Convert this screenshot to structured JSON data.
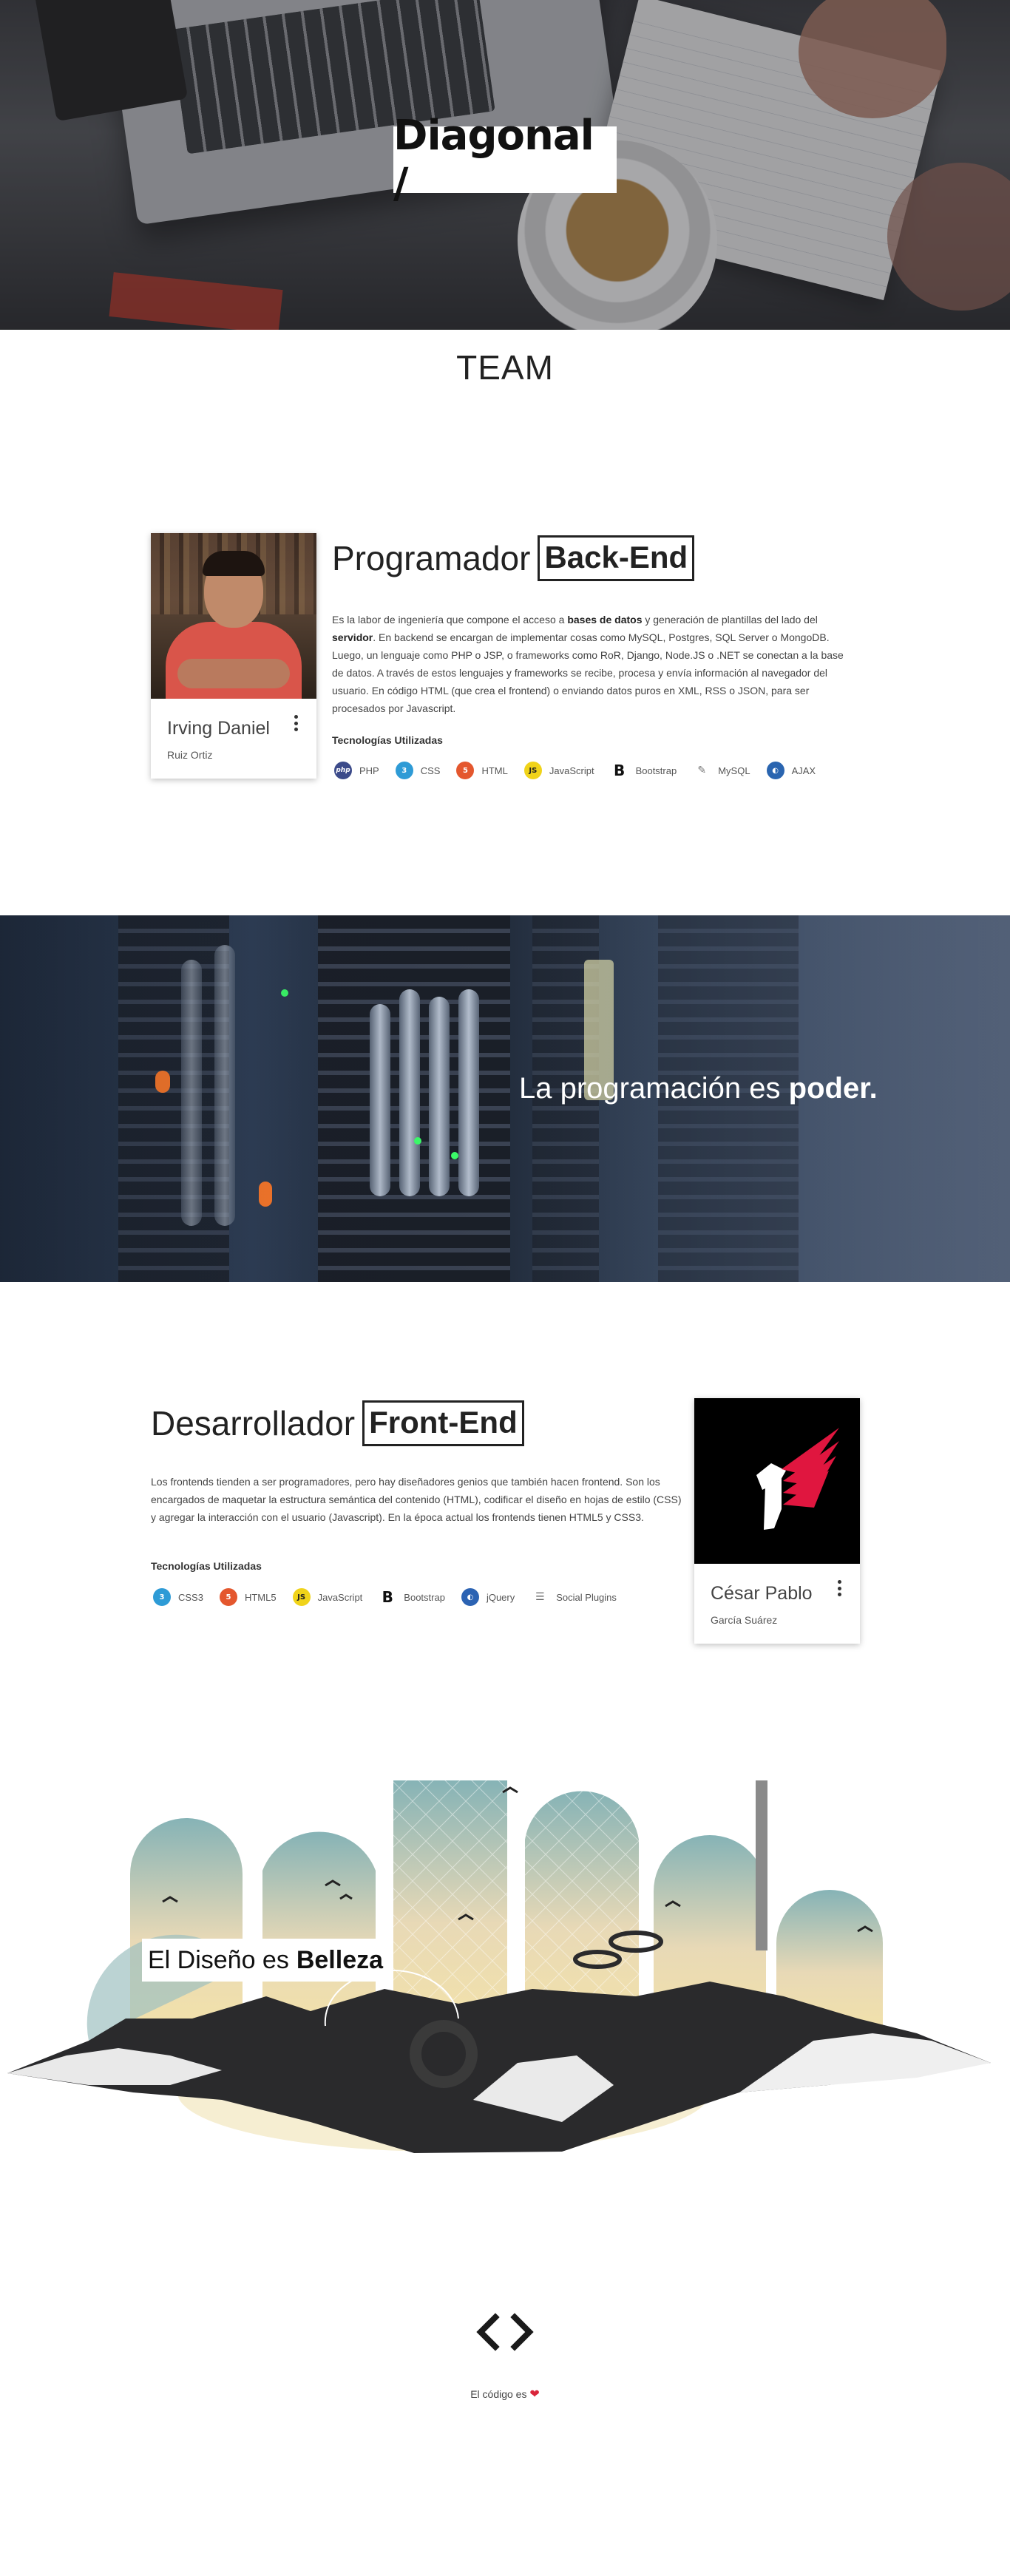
{
  "hero": {
    "brand": "Diagonal /"
  },
  "team": {
    "title": "TEAM"
  },
  "backend": {
    "role_light": "Programador",
    "role_boxed": "Back-End",
    "paragraph_1": "Es la labor de ingeniería que compone el acceso a ",
    "paragraph_bold_1": "bases de datos",
    "paragraph_2": " y generación de plantillas del lado del ",
    "paragraph_bold_2": "servidor",
    "paragraph_3": ". En backend se encargan de implementar cosas como MySQL, Postgres, SQL Server o MongoDB. Luego, un lenguaje como PHP o JSP, o frameworks como RoR, Django, Node.JS o .NET se conectan a la base de datos. A través de estos lenguajes y frameworks se recibe, procesa y envía información al navegador del usuario. En código HTML (que crea el frontend) o enviando datos puros en XML, RSS o JSON, para ser procesados por Javascript.",
    "tech_title": "Tecnologías Utilizadas",
    "tech": [
      {
        "icon": "php-icon",
        "badge": "php",
        "label": "PHP"
      },
      {
        "icon": "css-icon",
        "badge": "3",
        "label": "CSS"
      },
      {
        "icon": "html-icon",
        "badge": "5",
        "label": "HTML"
      },
      {
        "icon": "javascript-icon",
        "badge": "JS",
        "label": "JavaScript"
      },
      {
        "icon": "bootstrap-icon",
        "badge": "B",
        "label": "Bootstrap"
      },
      {
        "icon": "mysql-icon",
        "badge": "✎",
        "label": "MySQL"
      },
      {
        "icon": "ajax-icon",
        "badge": "◐",
        "label": "AJAX"
      }
    ],
    "card": {
      "name": "Irving Daniel",
      "sub": "Ruiz Ortiz"
    }
  },
  "banner": {
    "quote_light": "La programación es ",
    "quote_bold": "poder."
  },
  "frontend": {
    "role_light": "Desarrollador",
    "role_boxed": "Front-End",
    "paragraph": "Los frontends tienden a ser programadores, pero hay diseñadores genios que también hacen frontend. Son los encargados de maquetar la estructura semántica del contenido (HTML), codificar el diseño en hojas de estilo (CSS) y agregar la interacción con el usuario (Javascript). En la época actual los frontends tienen HTML5 y CSS3.",
    "tech_title": "Tecnologías Utilizadas",
    "tech": [
      {
        "icon": "css3-icon",
        "badge": "3",
        "label": "CSS3"
      },
      {
        "icon": "html5-icon",
        "badge": "5",
        "label": "HTML5"
      },
      {
        "icon": "javascript-icon",
        "badge": "JS",
        "label": "JavaScript"
      },
      {
        "icon": "bootstrap-icon",
        "badge": "B",
        "label": "Bootstrap"
      },
      {
        "icon": "jquery-icon",
        "badge": "◐",
        "label": "jQuery"
      },
      {
        "icon": "social-plugins-icon",
        "badge": "☰",
        "label": "Social Plugins"
      }
    ],
    "card": {
      "name": "César Pablo",
      "sub": "García Suárez"
    }
  },
  "design": {
    "label_light": "El Diseño es",
    "label_bold": "Belleza"
  },
  "footer": {
    "code_icon": "code-icon",
    "text": "El código es",
    "heart": "❤"
  },
  "colors": {
    "heart": "#d9243a",
    "card_bg": "#ffffff",
    "text": "#222222"
  }
}
